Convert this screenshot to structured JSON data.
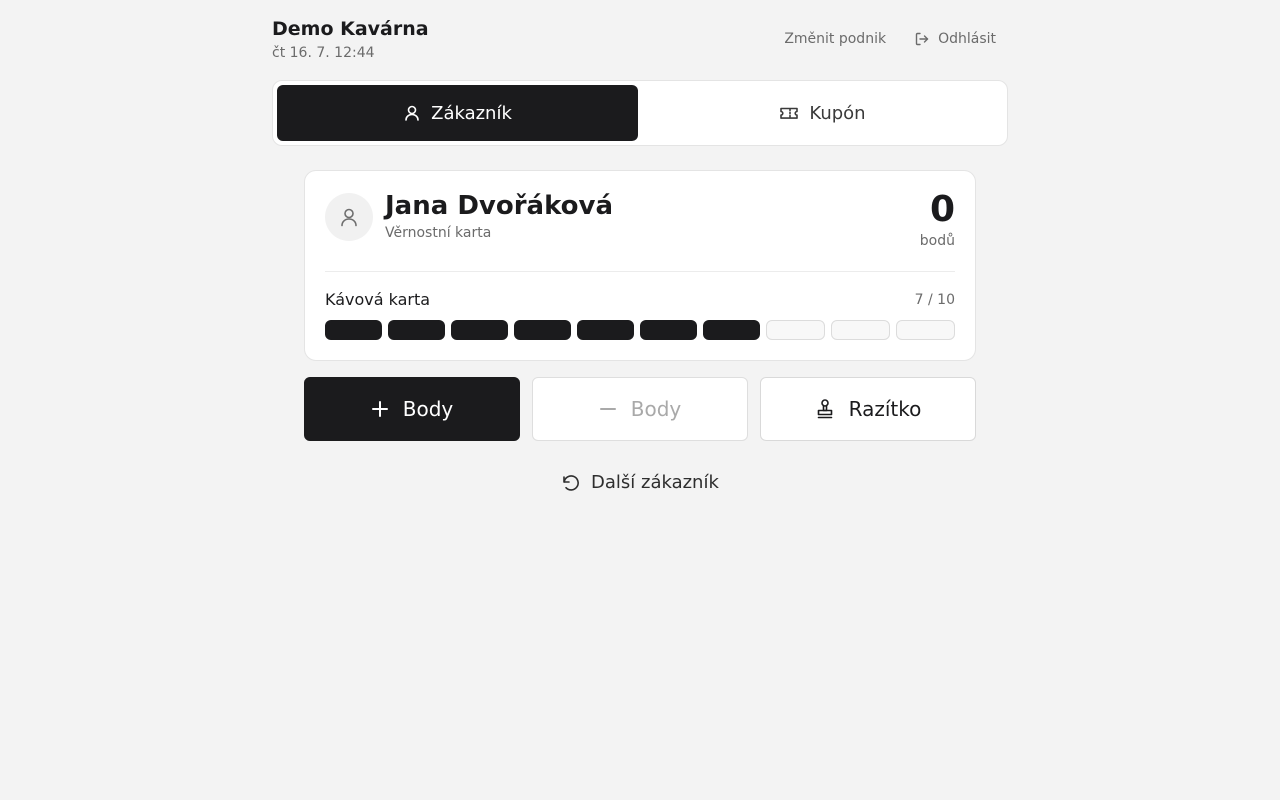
{
  "header": {
    "business_name": "Demo Kavárna",
    "datetime": "čt 16. 7. 12:44",
    "change_business_label": "Změnit podnik",
    "logout_label": "Odhlásit",
    "logout_icon": "logout-icon"
  },
  "tabs": [
    {
      "label": "Zákazník",
      "icon": "user-icon",
      "active": true
    },
    {
      "label": "Kupón",
      "icon": "ticket-icon",
      "active": false
    }
  ],
  "customer": {
    "name": "Jana Dvořáková",
    "subtitle": "Věrnostní karta",
    "points": "0",
    "points_unit": "bodů",
    "avatar_icon": "user-icon"
  },
  "stamp_card": {
    "label": "Kávová karta",
    "count_text": "7 / 10",
    "filled": 7,
    "total": 10
  },
  "actions": {
    "add_points_label": "Body",
    "subtract_points_label": "Body",
    "stamp_label": "Razítko"
  },
  "next_customer_label": "Další zákazník",
  "colors": {
    "background": "#f3f3f3",
    "primary": "#1b1b1d",
    "muted_text": "#6b6b6b",
    "disabled_text": "#a9a9a9"
  }
}
